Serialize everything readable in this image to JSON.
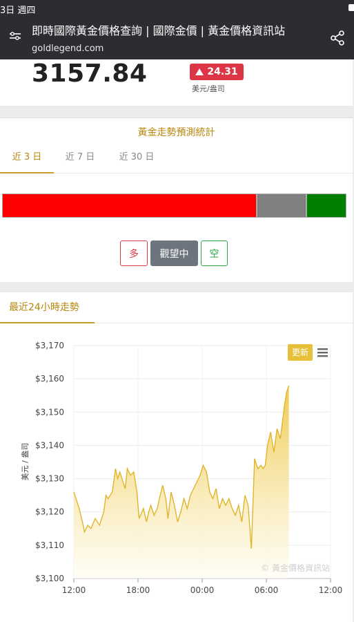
{
  "status_bar": {
    "time": "3日 週四"
  },
  "browser": {
    "page_title": "即時國際黃金價格查詢 | 國際金價 | 黃金價格資訊站",
    "url": "goldlegend.com"
  },
  "price": {
    "value": "3157.84",
    "change": "24.31",
    "direction": "up",
    "unit": "美元/盎司",
    "change_color": "#dc3545"
  },
  "forecast": {
    "title": "黃金走勢預測統計",
    "tabs": [
      {
        "label": "近 3 日",
        "active": true
      },
      {
        "label": "近 7 日",
        "active": false
      },
      {
        "label": "近 30 日",
        "active": false
      }
    ],
    "distribution": {
      "long": 0.74,
      "wait": 0.145,
      "short": 0.115
    },
    "colors": {
      "long": "#ff0000",
      "wait": "#808080",
      "short": "#008000"
    },
    "buttons": {
      "long": "多",
      "wait": "觀望中",
      "short": "空"
    }
  },
  "trend": {
    "tab_label": "最近24小時走勢",
    "refresh_label": "更新",
    "menu_icon": "hamburger-menu-icon",
    "watermark": "© 黃金價格資訊站",
    "accent_color": "#e6c039"
  },
  "chart_data": {
    "type": "area",
    "title": "",
    "xlabel": "",
    "ylabel": "美元 / 盎司",
    "ylim": [
      3100,
      3170
    ],
    "xlim_hours": [
      0,
      24
    ],
    "y_ticks": [
      "$3,100",
      "$3,110",
      "$3,120",
      "$3,130",
      "$3,140",
      "$3,150",
      "$3,160",
      "$3,170"
    ],
    "x_ticks": [
      "12:00",
      "18:00",
      "00:00",
      "06:00",
      "12:00"
    ],
    "series": [
      {
        "x": [
          0,
          0.5,
          0.8,
          1.0,
          1.3,
          1.6,
          2.0,
          2.4,
          2.8,
          3.0,
          3.2,
          3.6,
          3.9,
          4.1,
          4.3,
          4.6,
          4.8,
          5.0,
          5.3,
          5.6,
          5.9,
          6.1,
          6.5,
          6.8,
          7.0,
          7.2,
          7.5,
          7.8,
          8.0,
          8.3,
          8.6,
          8.8,
          9.1,
          9.4,
          9.7,
          10.0,
          10.3,
          10.6,
          10.9,
          11.2,
          11.5,
          11.8,
          12.1,
          12.4,
          12.7,
          13.0,
          13.3,
          13.6,
          13.9,
          14.2,
          14.5,
          14.8,
          15.1,
          15.4,
          15.7,
          16.0,
          16.3,
          16.6,
          16.9,
          17.2,
          17.5,
          17.7,
          17.9,
          18.1,
          18.4,
          18.7,
          19.0,
          19.3,
          19.5,
          19.7,
          19.9,
          20.1
        ],
        "y": [
          3126,
          3121,
          3117,
          3114,
          3116,
          3115,
          3118,
          3116,
          3120,
          3125,
          3124,
          3126,
          3133,
          3130,
          3132,
          3129,
          3127,
          3133,
          3131,
          3132,
          3126,
          3118,
          3121,
          3117,
          3120,
          3122,
          3119,
          3121,
          3124,
          3128,
          3124,
          3118,
          3126,
          3122,
          3117,
          3120,
          3124,
          3121,
          3125,
          3127,
          3129,
          3131,
          3134,
          3132,
          3126,
          3124,
          3127,
          3121,
          3124,
          3122,
          3124,
          3121,
          3119,
          3122,
          3117,
          3125,
          3122,
          3109,
          3136,
          3133,
          3134,
          3133,
          3134,
          3140,
          3144,
          3138,
          3145,
          3142,
          3147,
          3152,
          3156,
          3158
        ]
      }
    ],
    "grid": true,
    "legend": "none"
  }
}
